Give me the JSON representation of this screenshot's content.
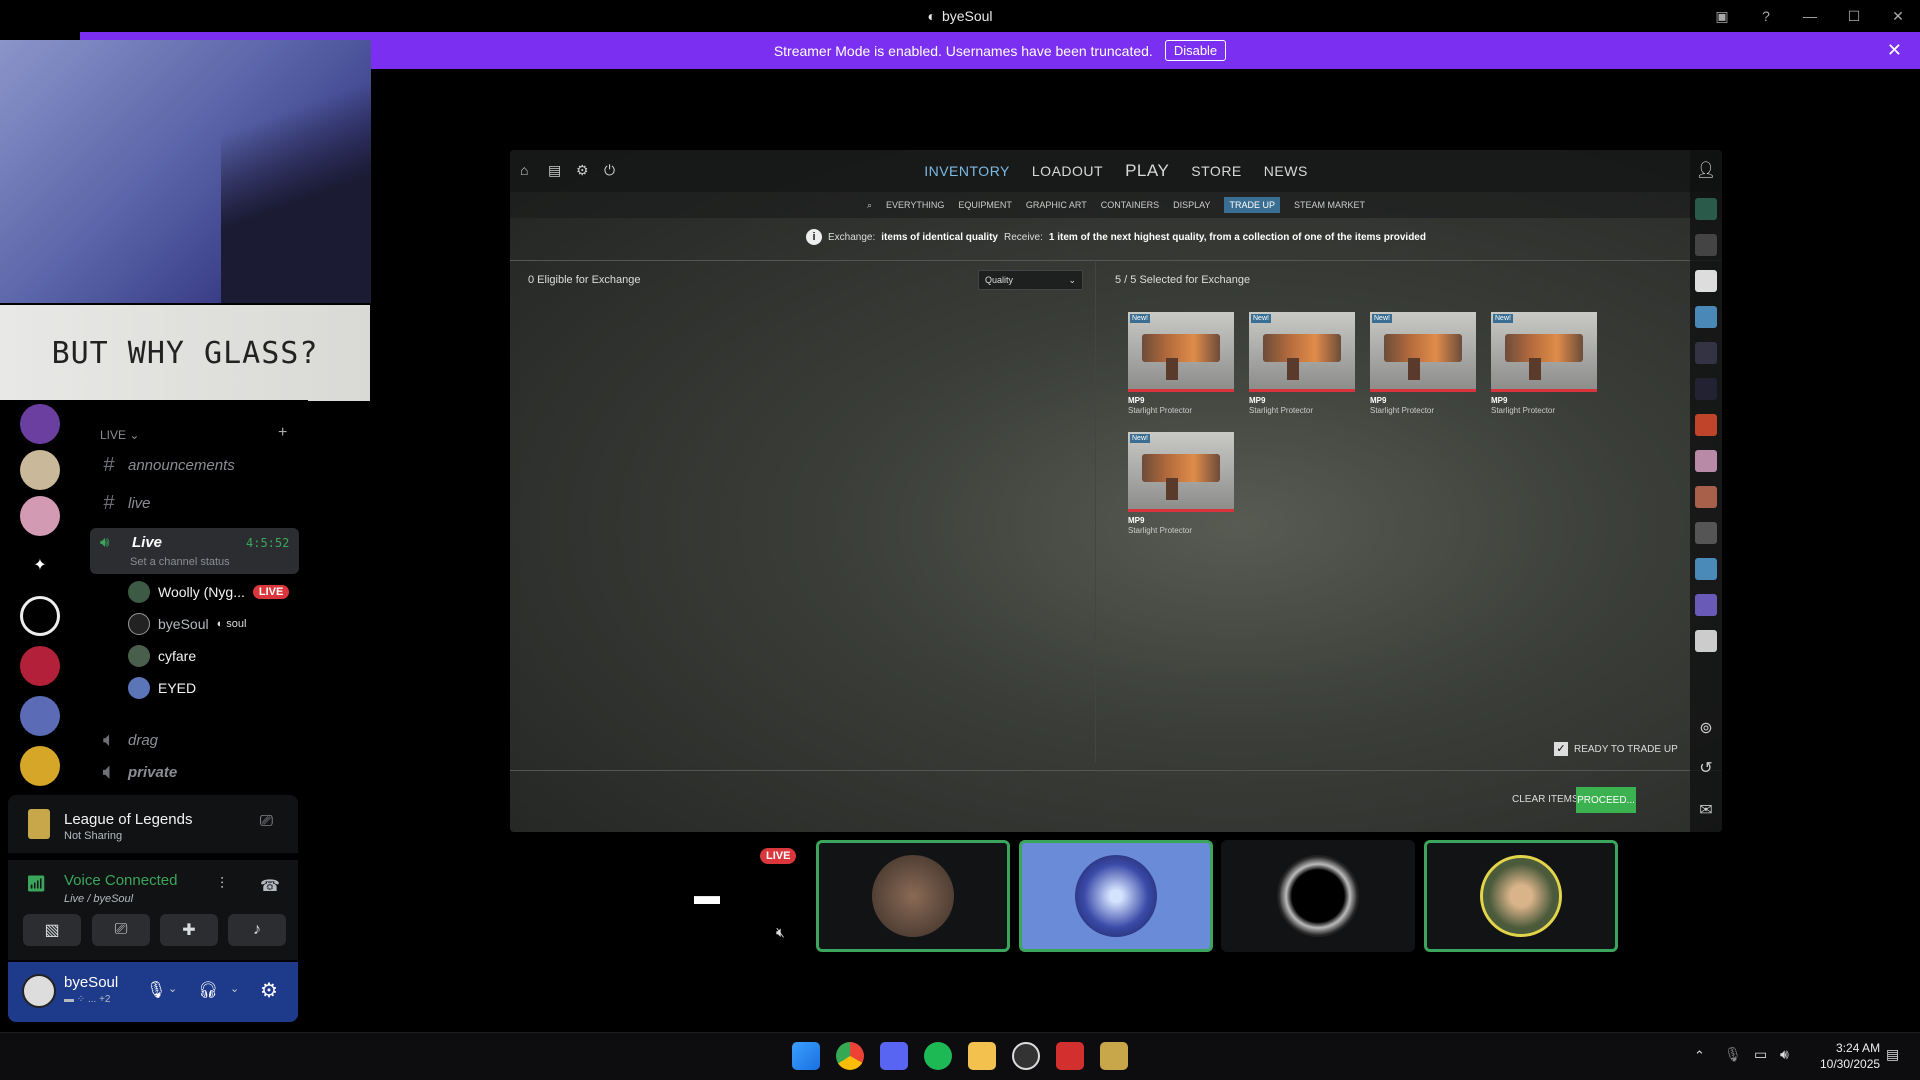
{
  "window": {
    "title": "byeSoul"
  },
  "banner": {
    "text": "Streamer Mode is enabled. Usernames have been truncated.",
    "button": "Disable"
  },
  "webcam": {
    "caption": "BUT WHY GLASS?"
  },
  "channels": {
    "category": "LIVE",
    "items": [
      {
        "type": "text",
        "name": "announcements"
      },
      {
        "type": "text",
        "name": "live"
      },
      {
        "type": "voice",
        "name": "Live",
        "timer": "4:5:52",
        "status": "Set a channel status"
      },
      {
        "type": "voice",
        "name": "drag"
      },
      {
        "type": "voice",
        "name": "private"
      }
    ],
    "voice_users": [
      {
        "name": "Woolly (Nyg...",
        "badge": "LIVE"
      },
      {
        "name": "byeSoul",
        "tag": "soul"
      },
      {
        "name": "cyfare"
      },
      {
        "name": "EYED"
      }
    ]
  },
  "activity": {
    "game": "League of Legends",
    "status": "Not Sharing"
  },
  "voice": {
    "title": "Voice Connected",
    "channel": "Live / byeSoul"
  },
  "user": {
    "name": "byeSoul",
    "sub": "+2"
  },
  "game": {
    "nav": [
      "INVENTORY",
      "LOADOUT",
      "PLAY",
      "STORE",
      "NEWS"
    ],
    "active_nav": "INVENTORY",
    "subnav": [
      "EVERYTHING",
      "EQUIPMENT",
      "GRAPHIC ART",
      "CONTAINERS",
      "DISPLAY",
      "TRADE UP",
      "STEAM MARKET"
    ],
    "active_subnav": "TRADE UP",
    "info": {
      "prefix": "Exchange:",
      "bold1": "items of identical quality",
      "mid": "Receive:",
      "bold2": "1 item of the next highest quality, from a collection of one of the items provided"
    },
    "eligible": "0 Eligible for Exchange",
    "sort": "Quality",
    "selected": "5 / 5 Selected for Exchange",
    "items": [
      {
        "badge": "New!",
        "weapon": "MP9",
        "skin": "Starlight Protector"
      },
      {
        "badge": "New!",
        "weapon": "MP9",
        "skin": "Starlight Protector"
      },
      {
        "badge": "New!",
        "weapon": "MP9",
        "skin": "Starlight Protector"
      },
      {
        "badge": "New!",
        "weapon": "MP9",
        "skin": "Starlight Protector"
      },
      {
        "badge": "New!",
        "weapon": "MP9",
        "skin": "Starlight Protector"
      }
    ],
    "ready": "READY TO TRADE UP",
    "clear": "CLEAR ITEMS",
    "proceed": "PROCEED..."
  },
  "stream": {
    "live_badge": "LIVE"
  },
  "clock": {
    "time": "3:24 AM",
    "date": "10/30/2025"
  },
  "colors": {
    "accent": "#7b2ff0",
    "live": "#da373c",
    "online": "#3ba55c",
    "proceed": "#3bb14f"
  }
}
